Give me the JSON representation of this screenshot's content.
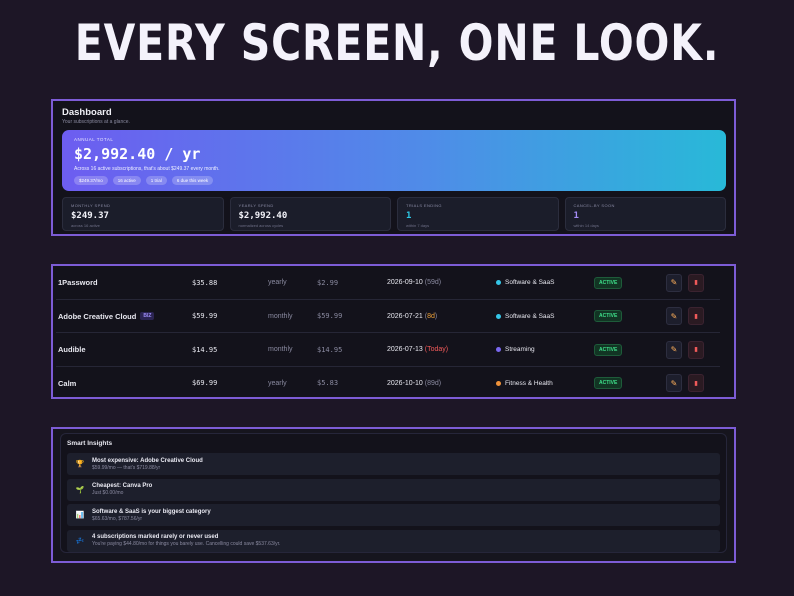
{
  "headline": "EVERY SCREEN, ONE LOOK.",
  "dashboard": {
    "title": "Dashboard",
    "subtitle": "Your subscriptions at a glance.",
    "hero": {
      "label": "ANNUAL TOTAL",
      "value": "$2,992.40 / yr",
      "description": "Across 16 active subscriptions, that's about $249.37 every month.",
      "chips": [
        "$249.37/mo",
        "16 active",
        "1 trial",
        "6 due this week"
      ]
    },
    "stats": [
      {
        "label": "MONTHLY SPEND",
        "value": "$249.37",
        "note": "across 16 active"
      },
      {
        "label": "YEARLY SPEND",
        "value": "$2,992.40",
        "note": "normalized across cycles"
      },
      {
        "label": "TRIALS ENDING",
        "value": "1",
        "note": "within 7 days"
      },
      {
        "label": "CANCEL-BY SOON",
        "value": "1",
        "note": "within 14 days"
      }
    ]
  },
  "table": {
    "rows": [
      {
        "name": "1Password",
        "badge": "",
        "price": "$35.88",
        "cycle": "yearly",
        "monthly": "$2.99",
        "date": "2026-09-10",
        "due": "59d",
        "due_style": "muted",
        "category": "Software & SaaS",
        "category_color": "#35c6e8",
        "status": "ACTIVE"
      },
      {
        "name": "Adobe Creative Cloud",
        "badge": "BIZ",
        "price": "$59.99",
        "cycle": "monthly",
        "monthly": "$59.99",
        "date": "2026-07-21",
        "due": "8d",
        "due_style": "warn",
        "category": "Software & SaaS",
        "category_color": "#35c6e8",
        "status": "ACTIVE"
      },
      {
        "name": "Audible",
        "badge": "",
        "price": "$14.95",
        "cycle": "monthly",
        "monthly": "$14.95",
        "date": "2026-07-13",
        "due": "Today",
        "due_style": "today",
        "category": "Streaming",
        "category_color": "#7a68f0",
        "status": "ACTIVE"
      },
      {
        "name": "Calm",
        "badge": "",
        "price": "$69.99",
        "cycle": "yearly",
        "monthly": "$5.83",
        "date": "2026-10-10",
        "due": "89d",
        "due_style": "muted",
        "category": "Fitness & Health",
        "category_color": "#f0923a",
        "status": "ACTIVE"
      }
    ]
  },
  "insights": {
    "title": "Smart Insights",
    "items": [
      {
        "icon": "trophy-icon",
        "glyph": "🏆",
        "head": "Most expensive: Adobe Creative Cloud",
        "desc": "$59.99/mo — that's $719.88/yr"
      },
      {
        "icon": "leaf-icon",
        "glyph": "🌱",
        "head": "Cheapest: Canva Pro",
        "desc": "Just $0.00/mo"
      },
      {
        "icon": "bar-chart-icon",
        "glyph": "📊",
        "head": "Software & SaaS is your biggest category",
        "desc": "$65.63/mo, $787.56/yr"
      },
      {
        "icon": "sleep-icon",
        "glyph": "💤",
        "head": "4 subscriptions marked rarely or never used",
        "desc": "You're paying $44.80/mo for things you barely use. Cancelling could save $537.63/yr."
      }
    ]
  }
}
